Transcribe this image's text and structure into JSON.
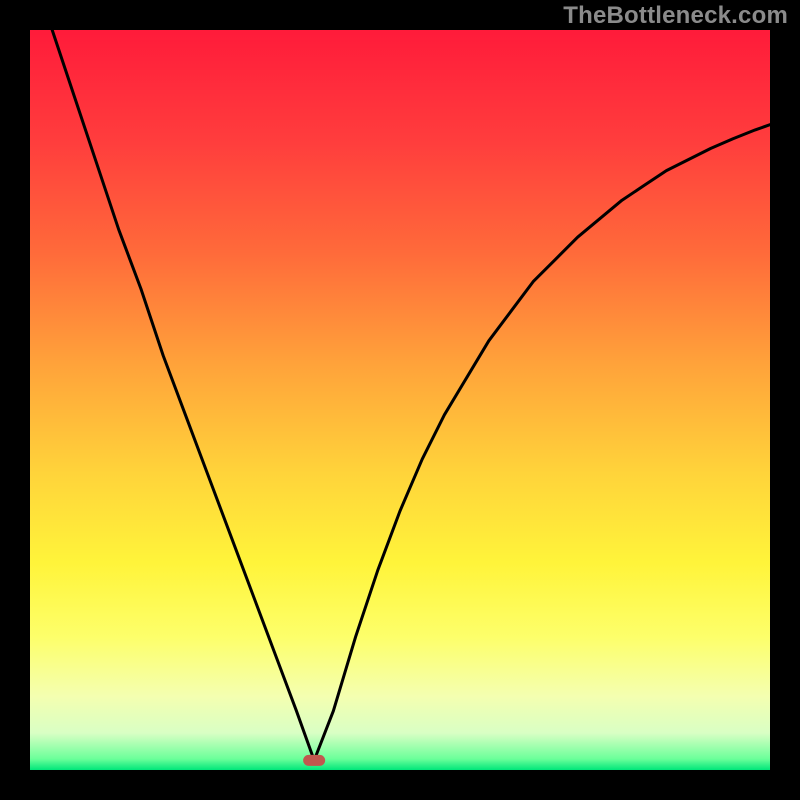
{
  "watermark": "TheBottleneck.com",
  "chart_data": {
    "type": "line",
    "title": "",
    "xlabel": "",
    "ylabel": "",
    "xlim": [
      0,
      100
    ],
    "ylim": [
      0,
      100
    ],
    "minimum_marker": {
      "x": 38.4,
      "y": 1.3
    },
    "curve_points_xy": [
      [
        3,
        100
      ],
      [
        6,
        91
      ],
      [
        9,
        82
      ],
      [
        12,
        73
      ],
      [
        15,
        65
      ],
      [
        18,
        56
      ],
      [
        21,
        48
      ],
      [
        24,
        40
      ],
      [
        27,
        32
      ],
      [
        30,
        24
      ],
      [
        33,
        16
      ],
      [
        36,
        8
      ],
      [
        38.4,
        1.3
      ],
      [
        41,
        8
      ],
      [
        44,
        18
      ],
      [
        47,
        27
      ],
      [
        50,
        35
      ],
      [
        53,
        42
      ],
      [
        56,
        48
      ],
      [
        59,
        53
      ],
      [
        62,
        58
      ],
      [
        65,
        62
      ],
      [
        68,
        66
      ],
      [
        71,
        69
      ],
      [
        74,
        72
      ],
      [
        77,
        74.5
      ],
      [
        80,
        77
      ],
      [
        83,
        79
      ],
      [
        86,
        81
      ],
      [
        89,
        82.5
      ],
      [
        92,
        84
      ],
      [
        95,
        85.3
      ],
      [
        98,
        86.5
      ],
      [
        100,
        87.2
      ]
    ],
    "gradient_stops": [
      {
        "offset": 0.0,
        "color": "#ff1b3a"
      },
      {
        "offset": 0.15,
        "color": "#ff3d3d"
      },
      {
        "offset": 0.3,
        "color": "#ff6a3a"
      },
      {
        "offset": 0.45,
        "color": "#ffa23a"
      },
      {
        "offset": 0.6,
        "color": "#ffd43a"
      },
      {
        "offset": 0.72,
        "color": "#fff43a"
      },
      {
        "offset": 0.82,
        "color": "#fdff6a"
      },
      {
        "offset": 0.9,
        "color": "#f4ffb0"
      },
      {
        "offset": 0.95,
        "color": "#d9ffc4"
      },
      {
        "offset": 0.985,
        "color": "#6bff9a"
      },
      {
        "offset": 1.0,
        "color": "#00e67a"
      }
    ],
    "marker_color": "#c0574e",
    "curve_color": "#000000"
  }
}
